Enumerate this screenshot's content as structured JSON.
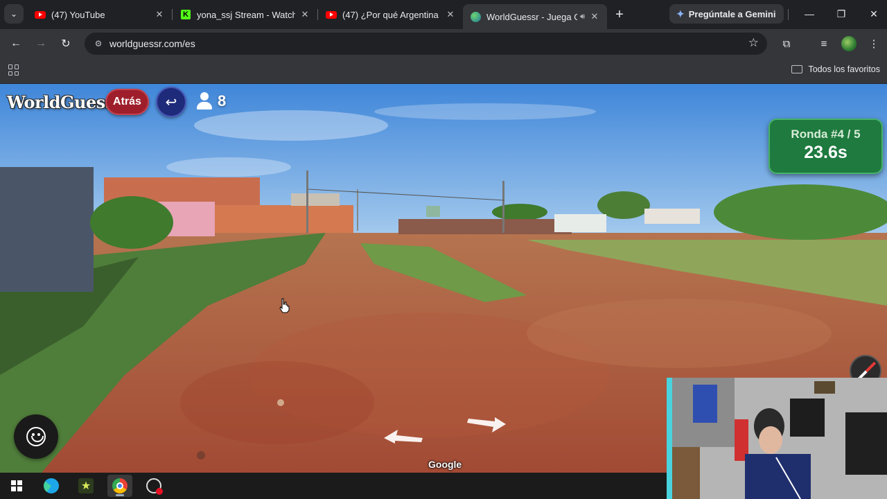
{
  "browser": {
    "tabs": [
      {
        "title": "(47) YouTube",
        "favicon": "youtube-icon",
        "active": false
      },
      {
        "title": "yona_ssj Stream - Watch Live",
        "favicon": "kick-icon",
        "active": false
      },
      {
        "title": "(47) ¿Por qué Argentina es",
        "favicon": "youtube-icon",
        "active": false
      },
      {
        "title": "WorldGuessr - Juega G",
        "favicon": "worldguessr-icon",
        "active": true
      }
    ],
    "gemini_label": "Pregúntale a Gemini",
    "url": "worldguessr.com/es",
    "bookmarks_all": "Todos los favoritos"
  },
  "game": {
    "logo": "WorldGuessr",
    "back_label": "Atrás",
    "players_count": "8",
    "round_label": "Ronda #4 / 5",
    "timer": "23.6s",
    "attribution": "Google"
  },
  "colors": {
    "round_box_bg": "#1e7a3e",
    "back_button": "#9e1f2b",
    "return_button": "#1e2a7a"
  }
}
